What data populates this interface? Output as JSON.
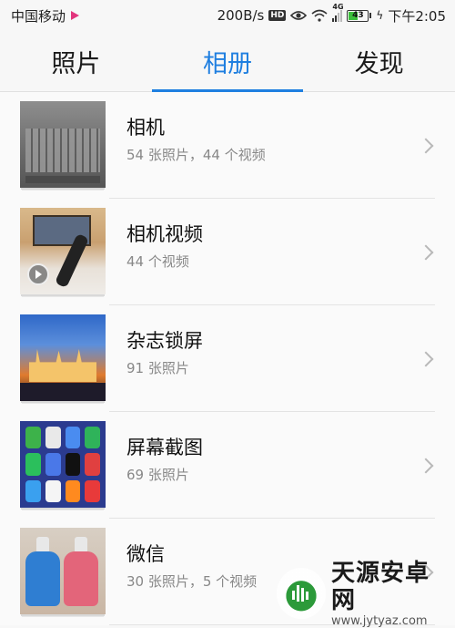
{
  "status_bar": {
    "carrier": "中国移动",
    "speed": "200B/s",
    "hd": "HD",
    "network": "4G",
    "battery_level": "43",
    "time": "下午2:05"
  },
  "tabs": [
    {
      "label": "照片",
      "active": false
    },
    {
      "label": "相册",
      "active": true
    },
    {
      "label": "发现",
      "active": false
    }
  ],
  "albums": [
    {
      "name": "相机",
      "count": "54 张照片，44 个视频"
    },
    {
      "name": "相机视频",
      "count": "44 个视频"
    },
    {
      "name": "杂志锁屏",
      "count": "91 张照片"
    },
    {
      "name": "屏幕截图",
      "count": "69 张照片"
    },
    {
      "name": "微信",
      "count": "30 张照片，5 个视频"
    }
  ],
  "watermark": {
    "title": "天源安卓网",
    "url": "www.jytyaz.com"
  },
  "colors": {
    "accent": "#1f7fe0",
    "battery": "#3bbf3b",
    "brand_green": "#2c9a3a"
  }
}
